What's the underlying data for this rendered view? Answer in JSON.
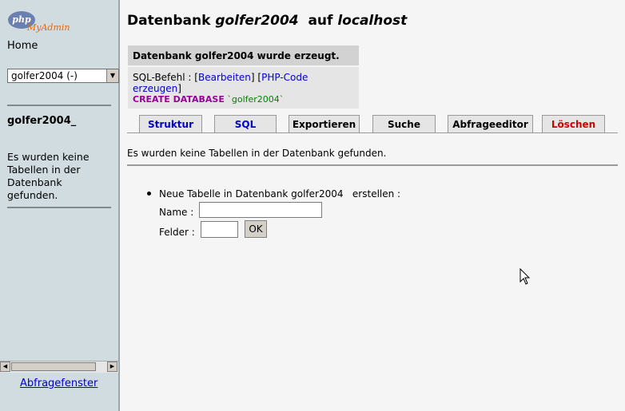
{
  "sidebar": {
    "logo_text_php": "php",
    "logo_text_myadmin": "MyAdmin",
    "home": "Home",
    "db_select_value": "golfer2004   (-)",
    "db_name": "golfer2004_",
    "no_tables": "Es wurden keine Tabellen in der Datenbank gefunden.",
    "query_window_link": "Abfragefenster"
  },
  "main": {
    "title_prefix": "Datenbank ",
    "title_db": "golfer2004",
    "title_mid": "  auf ",
    "title_host": "localhost",
    "message_head": "Datenbank golfer2004  wurde erzeugt.",
    "sql_label": "SQL-Befehl : ",
    "edit_link": "Bearbeiten",
    "php_link": "PHP-Code erzeugen",
    "sql_keyword": "CREATE DATABASE",
    "sql_value": " `golfer2004`",
    "tabs": [
      {
        "label": "Struktur",
        "color": "#0000cc"
      },
      {
        "label": "SQL",
        "color": "#0000cc"
      },
      {
        "label": "Exportieren",
        "color": "#000000"
      },
      {
        "label": "Suche",
        "color": "#000000"
      },
      {
        "label": "Abfrageeditor",
        "color": "#000000"
      },
      {
        "label": "Löschen",
        "color": "#cc0000"
      }
    ],
    "empty_message": "Es wurden keine Tabellen in der Datenbank gefunden.",
    "new_table_text": "Neue Tabelle in Datenbank golfer2004   erstellen :",
    "name_label": "Name :",
    "fields_label": "Felder :",
    "ok_button": "OK"
  }
}
